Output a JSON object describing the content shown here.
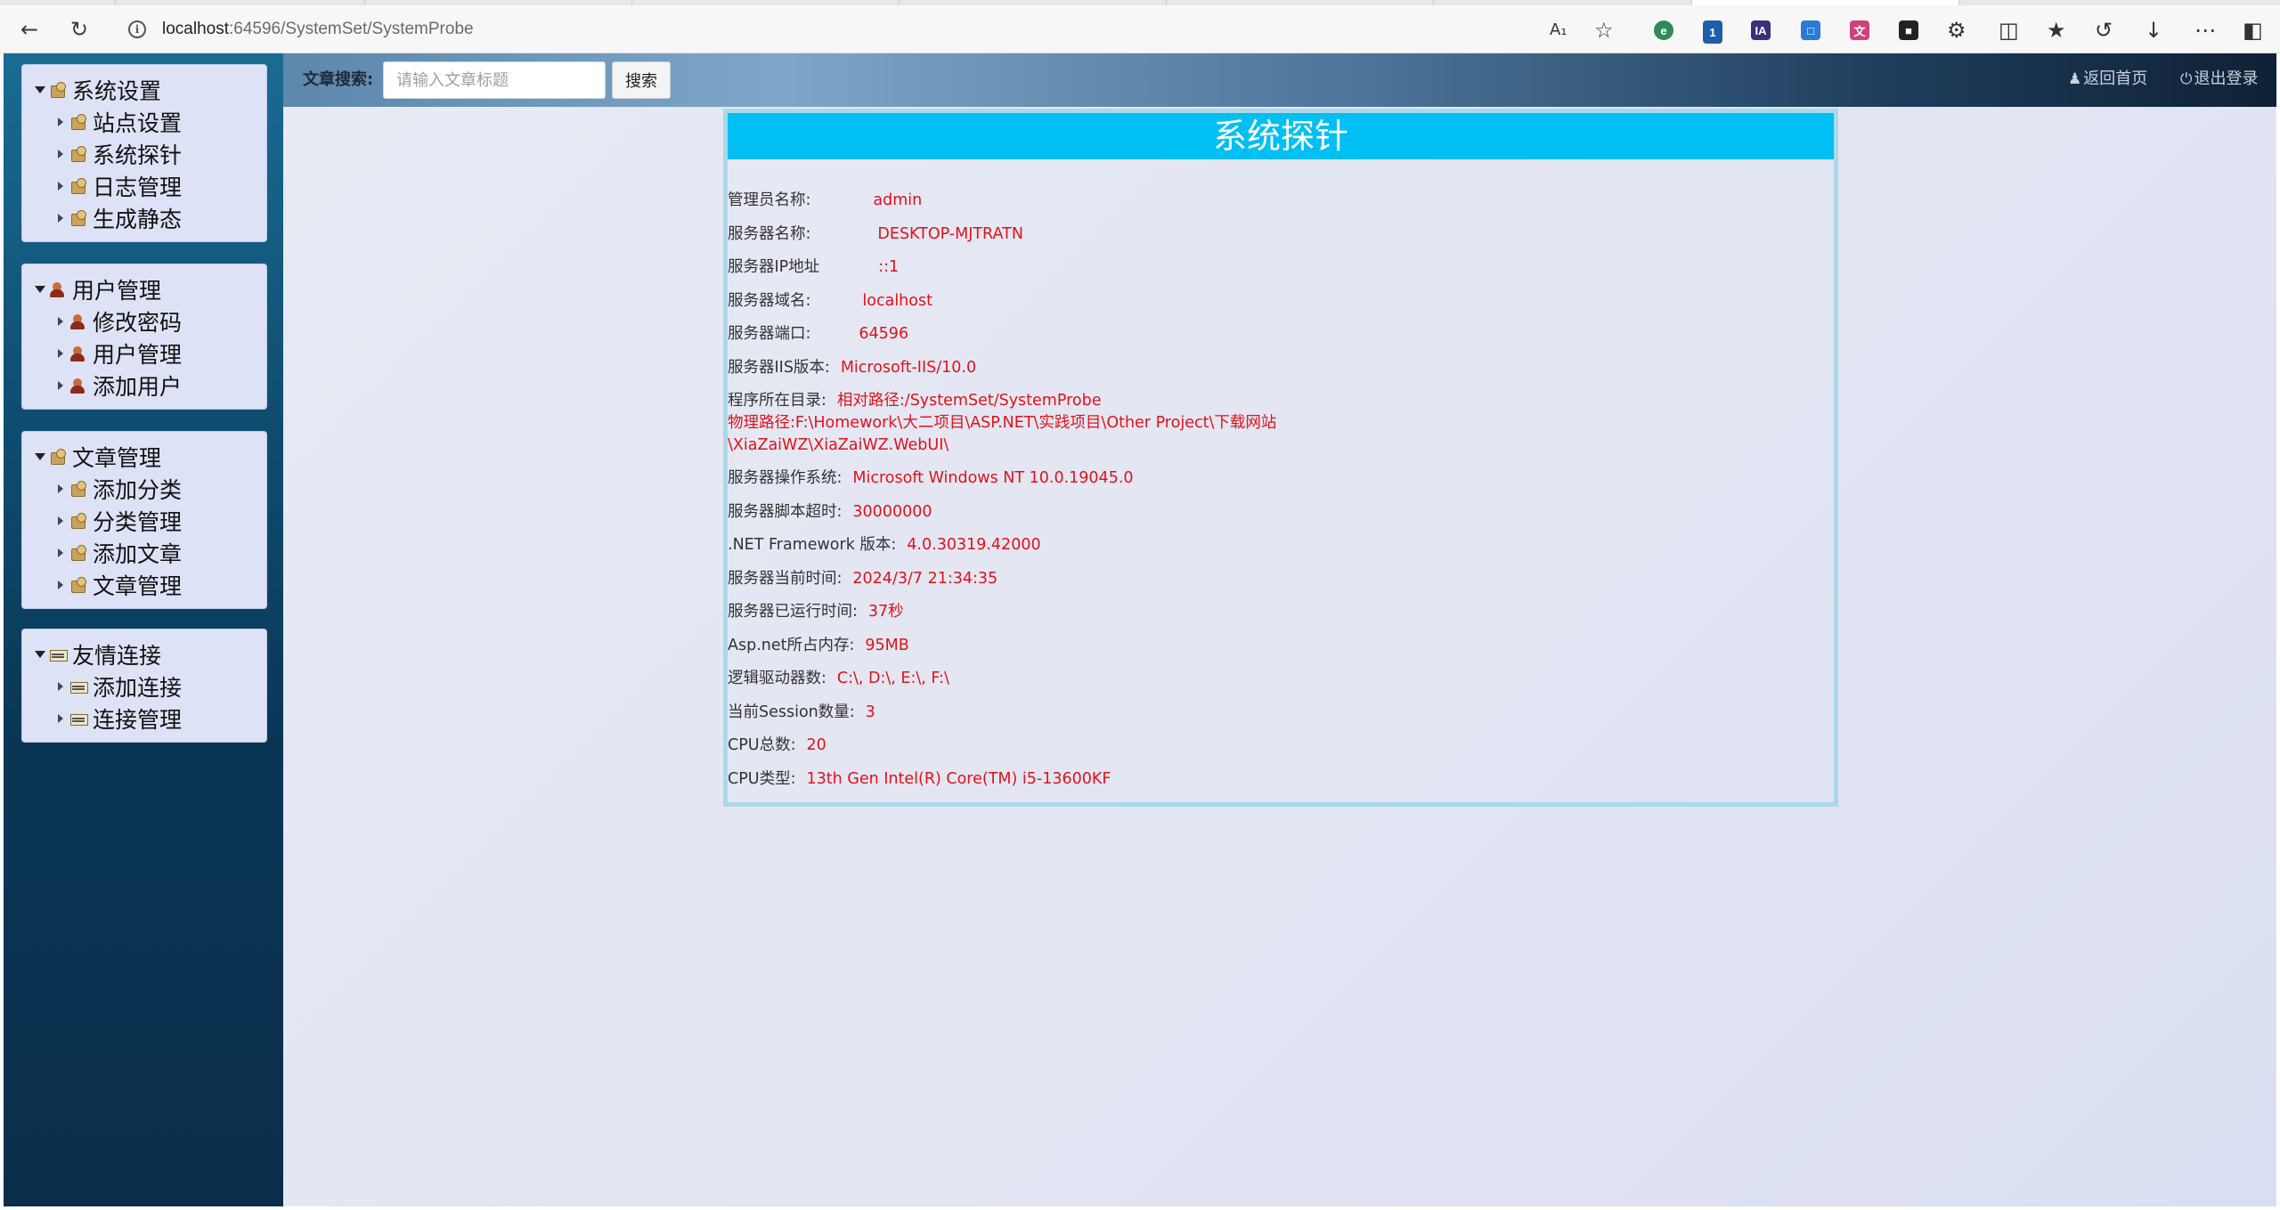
{
  "browser": {
    "url_host": "localhost",
    "url_path": ":64596/SystemSet/SystemProbe"
  },
  "header": {
    "search_label": "文章搜索:",
    "search_placeholder": "请输入文章标题",
    "search_button": "搜索",
    "home_link": "返回首页",
    "logout_link": "退出登录"
  },
  "sidebar": {
    "groups": [
      {
        "title": "系统设置",
        "items": [
          "站点设置",
          "系统探针",
          "日志管理",
          "生成静态"
        ]
      },
      {
        "title": "用户管理",
        "items": [
          "修改密码",
          "用户管理",
          "添加用户"
        ]
      },
      {
        "title": "文章管理",
        "items": [
          "添加分类",
          "分类管理",
          "添加文章",
          "文章管理"
        ]
      },
      {
        "title": "友情连接",
        "items": [
          "添加连接",
          "连接管理"
        ]
      }
    ]
  },
  "probe": {
    "title": "系统探针",
    "rows": [
      {
        "key": "管理员名称:",
        "value": "admin"
      },
      {
        "key": "服务器名称:",
        "value": "DESKTOP-MJTRATN"
      },
      {
        "key": "服务器IP地址",
        "value": "::1"
      },
      {
        "key": "服务器域名:",
        "value": "localhost"
      },
      {
        "key": "服务器端口:",
        "value": "64596"
      },
      {
        "key": "服务器IIS版本:",
        "value": "Microsoft-IIS/10.0"
      },
      {
        "key": "程序所在目录:",
        "value": "相对路径:/SystemSet/SystemProbe"
      },
      {
        "key": "",
        "value": "物理路径:F:\\Homework\\大二项目\\ASP.NET\\实践项目\\Other Project\\下载网站"
      },
      {
        "key": "",
        "value": "\\XiaZaiWZ\\XiaZaiWZ.WebUI\\"
      },
      {
        "key": "服务器操作系统:",
        "value": "Microsoft Windows NT 10.0.19045.0"
      },
      {
        "key": "服务器脚本超时:",
        "value": "30000000"
      },
      {
        "key": ".NET Framework 版本:",
        "value": "4.0.30319.42000"
      },
      {
        "key": "服务器当前时间:",
        "value": "2024/3/7 21:34:35"
      },
      {
        "key": "服务器已运行时间:",
        "value": "37秒"
      },
      {
        "key": "Asp.net所占内存:",
        "value": "95MB"
      },
      {
        "key": "逻辑驱动器数:",
        "value": "C:\\, D:\\, E:\\, F:\\"
      },
      {
        "key": "当前Session数量:",
        "value": "3"
      },
      {
        "key": "CPU总数:",
        "value": "20"
      },
      {
        "key": "CPU类型:",
        "value": "13th Gen Intel(R) Core(TM) i5-13600KF"
      }
    ]
  }
}
